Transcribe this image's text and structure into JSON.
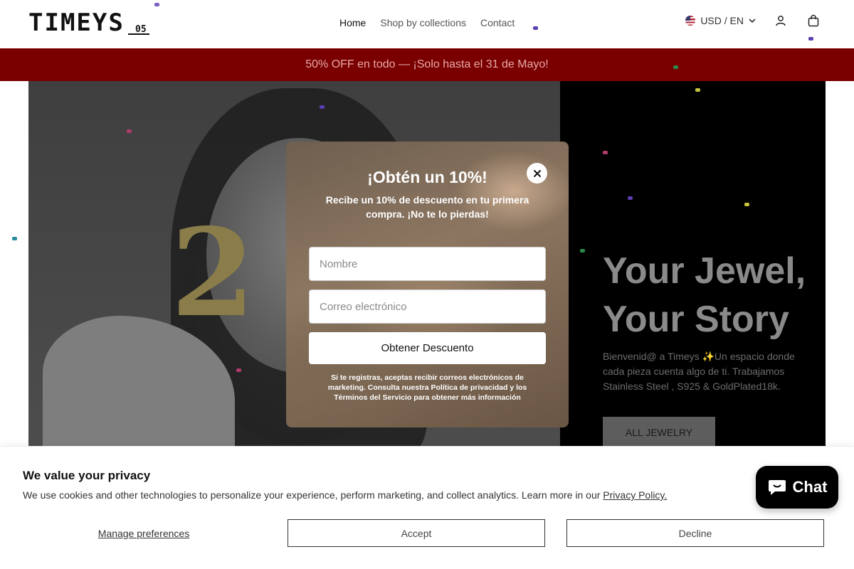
{
  "header": {
    "logo": "TIMEYS",
    "logo_sub": "05",
    "nav": [
      {
        "label": "Home",
        "active": true
      },
      {
        "label": "Shop by collections",
        "active": false
      },
      {
        "label": "Contact",
        "active": false
      }
    ],
    "locale": "USD / EN",
    "icons": {
      "locale_dropdown": "chevron-down-icon",
      "account": "account-icon",
      "cart": "bag-icon"
    }
  },
  "announcement": {
    "text": "50% OFF en todo — ¡Solo hasta el 31 de Mayo!",
    "background": "#7a0000"
  },
  "hero": {
    "title": "Your Jewel, Your Story",
    "description": "Bienvenid@ a Timeys ✨Un espacio donde cada pieza cuenta algo de ti. Trabajamos Stainless Steel , S925 & GoldPlated18k.",
    "button": "ALL JEWELRY"
  },
  "popup": {
    "title": "¡Obtén un 10%!",
    "subtitle": "Recibe un 10% de descuento en tu primera compra. ¡No te lo pierdas!",
    "name_placeholder": "Nombre",
    "email_placeholder": "Correo electrónico",
    "submit": "Obtener Descuento",
    "legal": "Si te registras, aceptas recibir correos electrónicos de marketing. Consulta nuestra Política de privacidad y los Términos del Servicio para obtener más información"
  },
  "cookie": {
    "title": "We value your privacy",
    "text": "We use cookies and other technologies to personalize your experience, perform marketing, and collect analytics. Learn more in our",
    "link": "Privacy Policy.",
    "manage": "Manage preferences",
    "accept": "Accept",
    "decline": "Decline"
  },
  "chat": {
    "label": "Chat"
  }
}
